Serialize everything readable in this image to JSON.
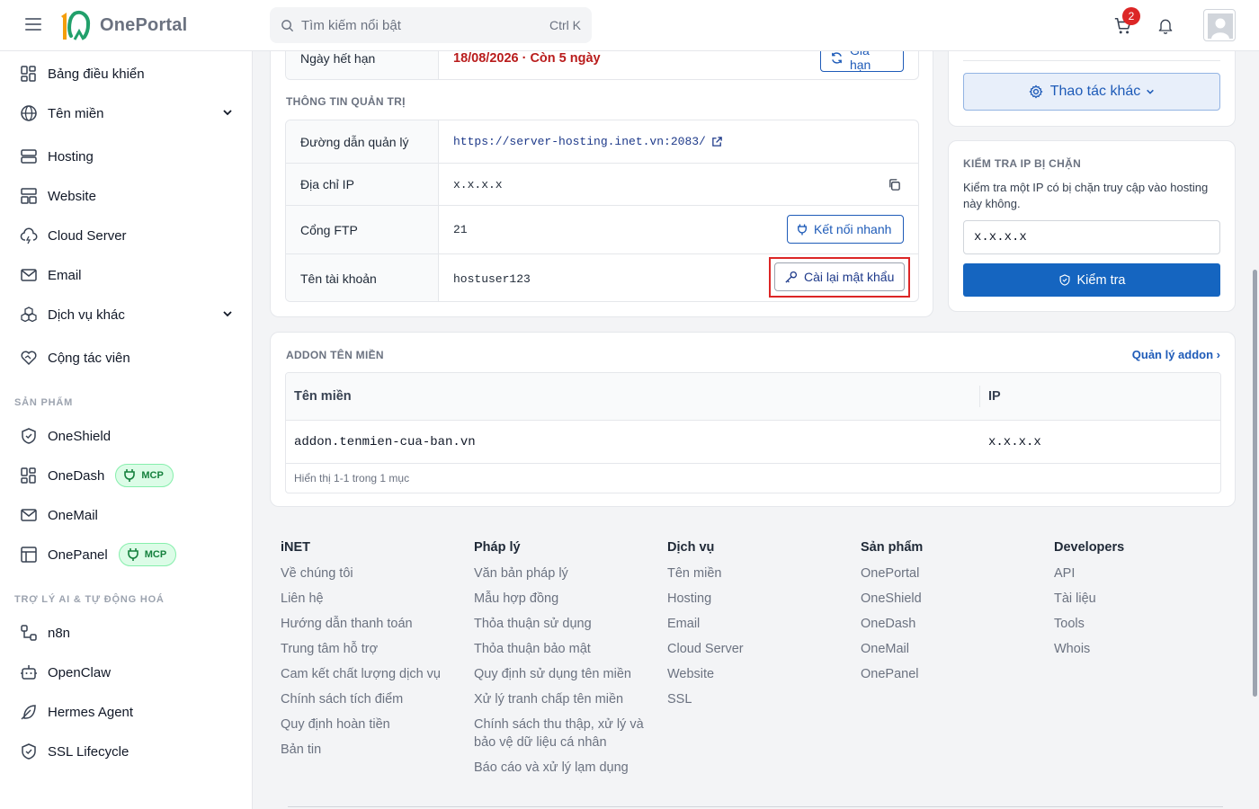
{
  "brand": {
    "name": "OnePortal",
    "logo_mark": "10"
  },
  "search": {
    "placeholder": "Tìm kiếm nổi bật",
    "shortcut": "Ctrl K"
  },
  "header": {
    "cart_count": "2"
  },
  "sidebar": {
    "items": [
      {
        "label": "Bảng điều khiển",
        "icon": "dashboard-grid-icon"
      },
      {
        "label": "Tên miền",
        "icon": "globe-icon",
        "expandable": true
      },
      {
        "label": "Hosting",
        "icon": "server-icon"
      },
      {
        "label": "Website",
        "icon": "layout-icon"
      },
      {
        "label": "Cloud Server",
        "icon": "cloud-icon"
      },
      {
        "label": "Email",
        "icon": "mail-icon"
      },
      {
        "label": "Dịch vụ khác",
        "icon": "boxes-icon",
        "expandable": true
      },
      {
        "label": "Cộng tác viên",
        "icon": "handshake-heart-icon"
      }
    ],
    "products_title": "SẢN PHẨM",
    "products": [
      {
        "label": "OneShield",
        "icon": "shield-icon"
      },
      {
        "label": "OneDash",
        "icon": "dashboard-grid-icon",
        "badge": "MCP"
      },
      {
        "label": "OneMail",
        "icon": "mail-icon"
      },
      {
        "label": "OnePanel",
        "icon": "panel-icon",
        "badge": "MCP"
      }
    ],
    "ai_title": "TRỢ LÝ AI & TỰ ĐỘNG HOÁ",
    "ai": [
      {
        "label": "n8n",
        "icon": "workflow-icon"
      },
      {
        "label": "OpenClaw",
        "icon": "bot-icon"
      },
      {
        "label": "Hermes Agent",
        "icon": "feather-icon"
      },
      {
        "label": "SSL Lifecycle",
        "icon": "shield-check-icon"
      }
    ]
  },
  "service_info": {
    "expiry_label": "Ngày hết hạn",
    "expiry_value": "18/08/2026 · Còn 5 ngày",
    "renew_button": "Gia hạn"
  },
  "admin_info": {
    "title": "THÔNG TIN QUẢN TRỊ",
    "rows": [
      {
        "key": "Đường dẫn quản lý",
        "value": "https://server-hosting.inet.vn:2083/"
      },
      {
        "key": "Địa chỉ IP",
        "value": "x.x.x.x"
      },
      {
        "key": "Cổng FTP",
        "value": "21",
        "action": "Kết nối nhanh"
      },
      {
        "key": "Tên tài khoản",
        "value": "hostuser123",
        "action": "Cài lại mật khẩu"
      }
    ]
  },
  "actions": {
    "more_button": "Thao tác khác"
  },
  "ip_check": {
    "title": "KIỂM TRA IP BỊ CHẶN",
    "description": "Kiểm tra một IP có bị chặn truy cập vào hosting này không.",
    "input_value": "x.x.x.x",
    "button": "Kiểm tra"
  },
  "addon": {
    "title": "ADDON TÊN MIỀN",
    "manage_link": "Quản lý addon ›",
    "columns": [
      "Tên miền",
      "IP"
    ],
    "rows": [
      {
        "domain": "addon.tenmien-cua-ban.vn",
        "ip": "x.x.x.x"
      }
    ],
    "footer": "Hiển thị 1-1 trong 1 mục"
  },
  "footer": {
    "columns": [
      {
        "title": "iNET",
        "links": [
          "Về chúng tôi",
          "Liên hệ",
          "Hướng dẫn thanh toán",
          "Trung tâm hỗ trợ",
          "Cam kết chất lượng dịch vụ",
          "Chính sách tích điểm",
          "Quy định hoàn tiền",
          "Bản tin"
        ]
      },
      {
        "title": "Pháp lý",
        "links": [
          "Văn bản pháp lý",
          "Mẫu hợp đồng",
          "Thỏa thuận sử dụng",
          "Thỏa thuận bảo mật",
          "Quy định sử dụng tên miền",
          "Xử lý tranh chấp tên miền",
          "Chính sách thu thập, xử lý và bảo vệ dữ liệu cá nhân",
          "Báo cáo và xử lý lạm dụng"
        ]
      },
      {
        "title": "Dịch vụ",
        "links": [
          "Tên miền",
          "Hosting",
          "Email",
          "Cloud Server",
          "Website",
          "SSL"
        ]
      },
      {
        "title": "Sản phẩm",
        "links": [
          "OnePortal",
          "OneShield",
          "OneDash",
          "OneMail",
          "OnePanel"
        ]
      },
      {
        "title": "Developers",
        "links": [
          "API",
          "Tài liệu",
          "Tools",
          "Whois"
        ]
      }
    ]
  },
  "colors": {
    "primary": "#1565c0",
    "danger": "#b91c1c",
    "highlight": "#dc2626",
    "mcp_bg": "#dcfce7"
  }
}
